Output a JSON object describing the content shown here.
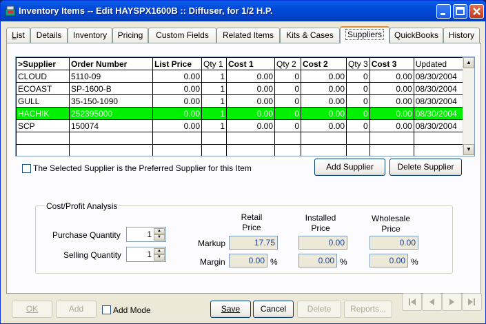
{
  "window": {
    "title": "Inventory Items -- Edit HAYSPX1600B :: Diffuser, for 1/2 H.P.",
    "controls": [
      "minimize-icon",
      "maximize-icon",
      "close-icon"
    ]
  },
  "tabs": [
    {
      "label": "List",
      "key": "L",
      "rest": "ist"
    },
    {
      "label": "Details",
      "key": "",
      "rest": "Details"
    },
    {
      "label": "Inventory",
      "key": "",
      "rest": "Inventory"
    },
    {
      "label": "Pricing",
      "key": "",
      "rest": "Pricing"
    },
    {
      "label": "Custom Fields",
      "key": "",
      "rest": "Custom Fields"
    },
    {
      "label": "Related Items",
      "key": "",
      "rest": "Related Items"
    },
    {
      "label": "Kits & Cases",
      "key": "",
      "rest": "Kits & Cases"
    },
    {
      "label": "Suppliers",
      "key": "",
      "rest": "Suppliers"
    },
    {
      "label": "QuickBooks",
      "key": "",
      "rest": "QuickBooks"
    },
    {
      "label": "History",
      "key": "",
      "rest": "History"
    }
  ],
  "active_tab": "Suppliers",
  "grid": {
    "headers": [
      ">Supplier",
      "Order Number",
      "List Price",
      "Qty 1",
      "Cost 1",
      "Qty 2",
      "Cost 2",
      "Qty 3",
      "Cost 3",
      "Updated"
    ],
    "rows": [
      [
        "CLOUD",
        "5110-09",
        "0.00",
        "1",
        "0.00",
        "0",
        "0.00",
        "0",
        "0.00",
        "08/30/2004"
      ],
      [
        "ECOAST",
        "SP-1600-B",
        "0.00",
        "1",
        "0.00",
        "0",
        "0.00",
        "0",
        "0.00",
        "08/30/2004"
      ],
      [
        "GULL",
        "35-150-1090",
        "0.00",
        "1",
        "0.00",
        "0",
        "0.00",
        "0",
        "0.00",
        "08/30/2004"
      ],
      [
        "HACHIK",
        "252395000",
        "0.00",
        "1",
        "0.00",
        "0",
        "0.00",
        "0",
        "0.00",
        "08/30/2004"
      ],
      [
        "SCP",
        "150074",
        "0.00",
        "1",
        "0.00",
        "0",
        "0.00",
        "0",
        "0.00",
        "08/30/2004"
      ],
      [
        "",
        "",
        "",
        "",
        "",
        "",
        "",
        "",
        "",
        ""
      ],
      [
        "",
        "",
        "",
        "",
        "",
        "",
        "",
        "",
        "",
        ""
      ]
    ],
    "selected_row": 3,
    "selected_color": "#00f000"
  },
  "preferred_checkbox": {
    "label": "The Selected Supplier is the Preferred Supplier for this Item",
    "checked": false
  },
  "buttons": {
    "add_supplier": "Add Supplier",
    "delete_supplier": "Delete Supplier"
  },
  "analysis": {
    "title": "Cost/Profit Analysis",
    "purchase_quantity_label": "Purchase Quantity",
    "purchase_quantity": "1",
    "selling_quantity_label": "Selling Quantity",
    "selling_quantity": "1",
    "retail_header_1": "Retail",
    "retail_header_2": "Price",
    "installed_header_1": "Installed",
    "installed_header_2": "Price",
    "wholesale_header_1": "Wholesale",
    "wholesale_header_2": "Price",
    "markup_label": "Markup",
    "margin_label": "Margin",
    "retail_markup": "17.75",
    "installed_markup": "0.00",
    "wholesale_markup": "0.00",
    "retail_margin": "0.00",
    "installed_margin": "0.00",
    "wholesale_margin": "0.00",
    "percent": "%"
  },
  "footer": {
    "ok": "OK",
    "add": "Add",
    "add_mode": "Add Mode",
    "save": "Save",
    "cancel": "Cancel",
    "delete": "Delete",
    "reports": "Reports..."
  }
}
